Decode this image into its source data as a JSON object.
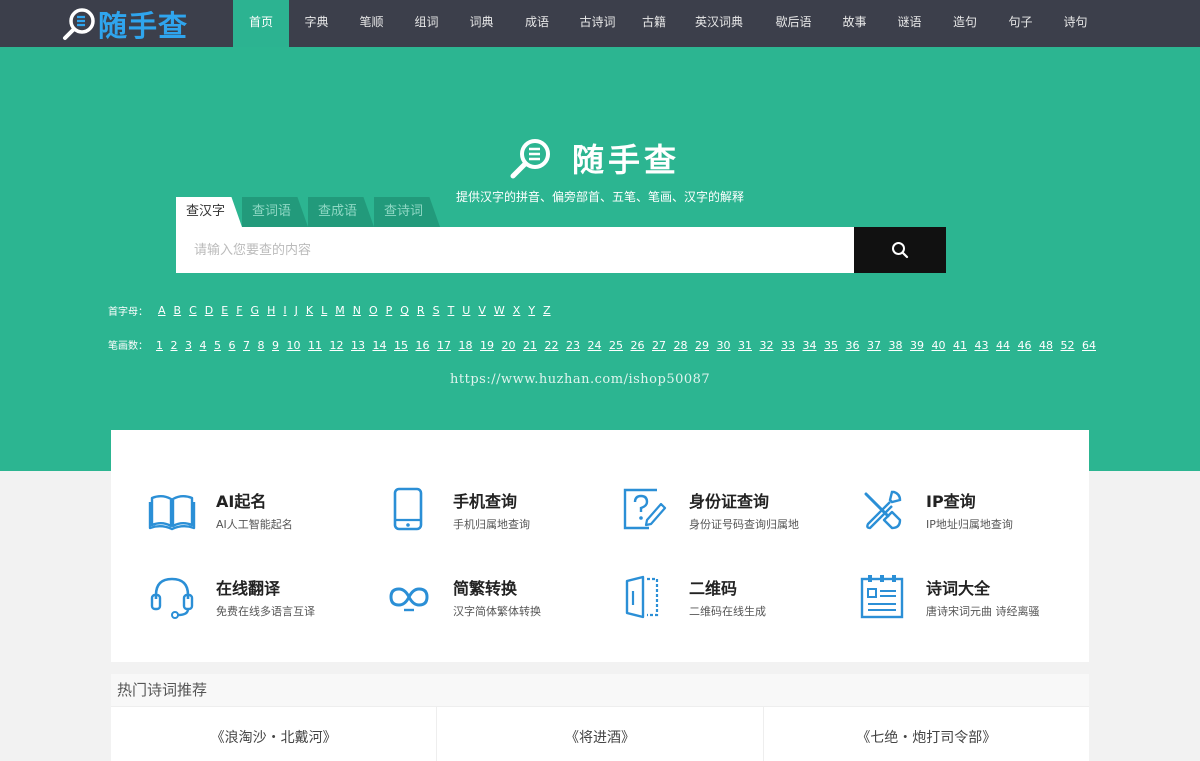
{
  "header": {
    "logo_text": "随手查",
    "nav": [
      {
        "label": "首页",
        "active": true
      },
      {
        "label": "字典"
      },
      {
        "label": "笔顺"
      },
      {
        "label": "组词"
      },
      {
        "label": "词典"
      },
      {
        "label": "成语"
      },
      {
        "label": "古诗词"
      },
      {
        "label": "古籍"
      },
      {
        "label": "英汉词典"
      },
      {
        "label": "歇后语"
      },
      {
        "label": "故事"
      },
      {
        "label": "谜语"
      },
      {
        "label": "造句"
      },
      {
        "label": "句子"
      },
      {
        "label": "诗句"
      }
    ]
  },
  "hero": {
    "title": "随手查",
    "subtitle": "提供汉字的拼音、偏旁部首、五笔、笔画、汉字的解释",
    "tabs": [
      "查汉字",
      "查词语",
      "查成语",
      "查诗词"
    ],
    "search": {
      "placeholder": "请输入您要查的内容",
      "value": ""
    },
    "letters_label": "首字母：",
    "letters": [
      "A",
      "B",
      "C",
      "D",
      "E",
      "F",
      "G",
      "H",
      "I",
      "J",
      "K",
      "L",
      "M",
      "N",
      "O",
      "P",
      "Q",
      "R",
      "S",
      "T",
      "U",
      "V",
      "W",
      "X",
      "Y",
      "Z"
    ],
    "strokes_label": "笔画数：",
    "strokes": [
      "1",
      "2",
      "3",
      "4",
      "5",
      "6",
      "7",
      "8",
      "9",
      "10",
      "11",
      "12",
      "13",
      "14",
      "15",
      "16",
      "17",
      "18",
      "19",
      "20",
      "21",
      "22",
      "23",
      "24",
      "25",
      "26",
      "27",
      "28",
      "29",
      "30",
      "31",
      "32",
      "33",
      "34",
      "35",
      "36",
      "37",
      "38",
      "39",
      "40",
      "41",
      "43",
      "44",
      "46",
      "48",
      "52",
      "64"
    ],
    "watermark": "https://www.huzhan.com/ishop50087"
  },
  "tools": [
    {
      "title": "AI起名",
      "desc": "AI人工智能起名",
      "icon": "book-icon"
    },
    {
      "title": "手机查询",
      "desc": "手机归属地查询",
      "icon": "phone-icon"
    },
    {
      "title": "身份证查询",
      "desc": "身份证号码查询归属地",
      "icon": "id-card-icon"
    },
    {
      "title": "IP查询",
      "desc": "IP地址归属地查询",
      "icon": "tools-icon"
    },
    {
      "title": "在线翻译",
      "desc": "免费在线多语言互译",
      "icon": "headset-icon"
    },
    {
      "title": "简繁转换",
      "desc": "汉字简体繁体转换",
      "icon": "infinity-icon"
    },
    {
      "title": "二维码",
      "desc": "二维码在线生成",
      "icon": "qrcode-icon"
    },
    {
      "title": "诗词大全",
      "desc": "唐诗宋词元曲 诗经离骚",
      "icon": "document-icon"
    }
  ],
  "hot_poems": {
    "title": "热门诗词推荐",
    "items": [
      "《浪淘沙・北戴河》",
      "《将进酒》",
      "《七绝・炮打司令部》"
    ]
  },
  "colors": {
    "nav_bg": "#3c3f4b",
    "brand_green": "#2cb591",
    "logo_blue": "#2fa5ee",
    "icon_blue": "#2b8fd6"
  }
}
